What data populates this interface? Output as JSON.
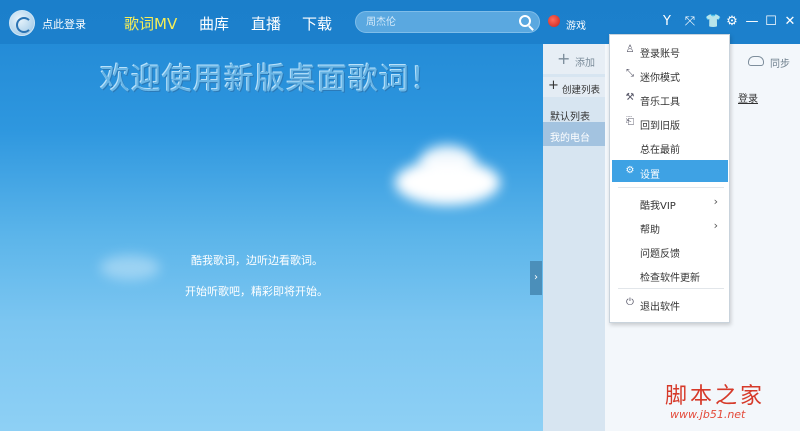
{
  "header": {
    "login": "点此登录",
    "nav": [
      "歌词MV",
      "曲库",
      "直播",
      "下载"
    ],
    "search_placeholder": "周杰伦",
    "game": "游戏"
  },
  "main": {
    "welcome_title": "欢迎使用新版桌面歌词！",
    "line1": "酷我歌词，边听边看歌词。",
    "line2": "开始听歌吧，精彩即将开始。"
  },
  "panel": {
    "add": "添加",
    "create": "创建列表",
    "default_list": "默认列表",
    "my_radio": "我的电台",
    "sync": "同步",
    "login": "登录"
  },
  "menu": {
    "items": [
      {
        "label": "登录账号",
        "icon": "user-icon"
      },
      {
        "label": "迷你模式",
        "icon": "mini-mode-icon"
      },
      {
        "label": "音乐工具",
        "icon": "tools-icon"
      },
      {
        "label": "回到旧版",
        "icon": "old-version-icon"
      },
      {
        "label": "总在最前",
        "icon": ""
      },
      {
        "label": "设置",
        "icon": "gear-icon"
      },
      {
        "label": "酷我VIP",
        "icon": ""
      },
      {
        "label": "帮助",
        "icon": ""
      },
      {
        "label": "问题反馈",
        "icon": ""
      },
      {
        "label": "检查软件更新",
        "icon": ""
      },
      {
        "label": "退出软件",
        "icon": "power-icon"
      }
    ],
    "highlight_color": "#3ea2e4"
  },
  "watermark": {
    "cn": "脚本之家",
    "url": "www.jb51.net"
  },
  "colors": {
    "topbar": "#1c80cc",
    "active_nav": "#f7ee56"
  }
}
